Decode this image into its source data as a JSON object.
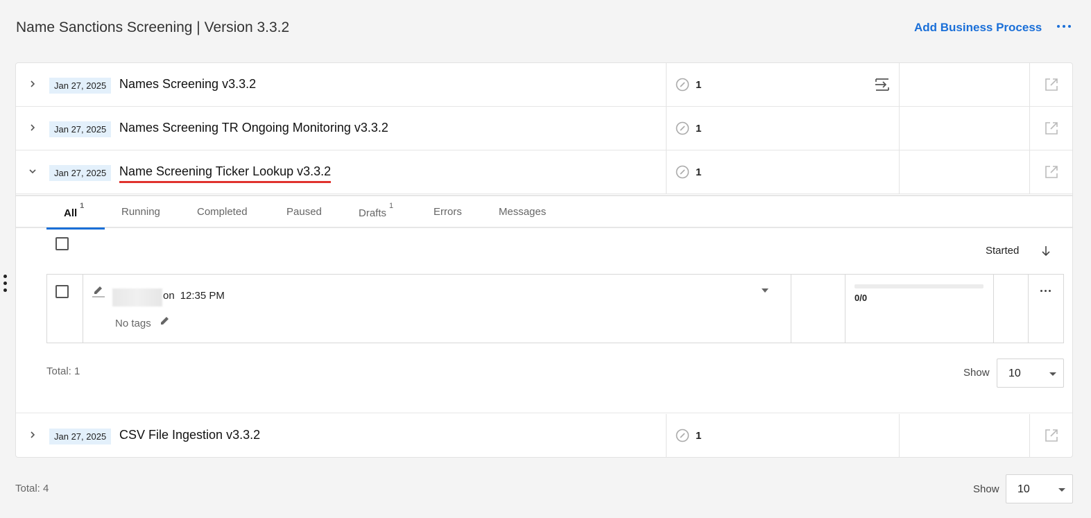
{
  "header": {
    "title": "Name Sanctions Screening | Version 3.3.2",
    "add_button": "Add Business Process",
    "more_icon": "more-horizontal-icon"
  },
  "processes": [
    {
      "date": "Jan 27, 2025",
      "name": "Names Screening v3.3.2",
      "count": "1",
      "expanded": false
    },
    {
      "date": "Jan 27, 2025",
      "name": "Names Screening TR Ongoing Monitoring v3.3.2",
      "count": "1",
      "expanded": false
    },
    {
      "date": "Jan 27, 2025",
      "name": "Name Screening Ticker Lookup v3.3.2",
      "count": "1",
      "expanded": true
    },
    {
      "date": "Jan 27, 2025",
      "name": "CSV File Ingestion v3.3.2",
      "count": "1",
      "expanded": false
    }
  ],
  "tabs": [
    {
      "label": "All",
      "badge": "1",
      "active": true
    },
    {
      "label": "Running",
      "badge": ""
    },
    {
      "label": "Completed",
      "badge": ""
    },
    {
      "label": "Paused",
      "badge": ""
    },
    {
      "label": "Drafts",
      "badge": "1"
    },
    {
      "label": "Errors",
      "badge": ""
    },
    {
      "label": "Messages",
      "badge": ""
    }
  ],
  "instances": {
    "sort_label": "Started",
    "item": {
      "on_text": "on",
      "time": "12:35 PM",
      "tags": "No tags",
      "progress_text": "0/0",
      "progress_fraction": 0
    },
    "total": "Total: 1",
    "show_label": "Show",
    "show_value": "10"
  },
  "footer": {
    "total": "Total: 4",
    "show_label": "Show",
    "show_value": "10"
  },
  "colors": {
    "accent": "#1a6fd8",
    "highlight_underline": "#e0332e",
    "date_badge_bg": "#e3f0fb"
  }
}
